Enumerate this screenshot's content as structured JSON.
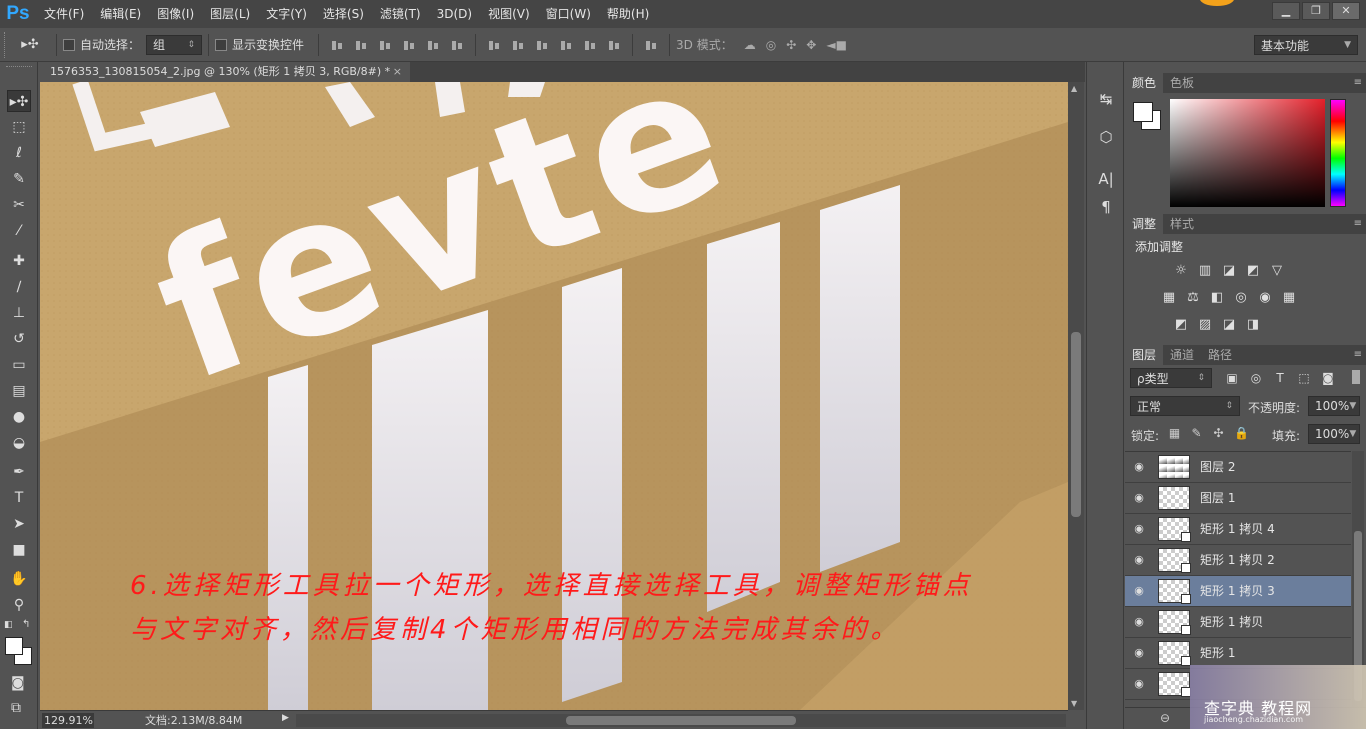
{
  "app": {
    "logo": "Ps"
  },
  "menu": [
    "文件(F)",
    "编辑(E)",
    "图像(I)",
    "图层(L)",
    "文字(Y)",
    "选择(S)",
    "滤镜(T)",
    "3D(D)",
    "视图(V)",
    "窗口(W)",
    "帮助(H)"
  ],
  "window_buttons": {
    "minimize": "▁",
    "restore": "❐",
    "close": "✕"
  },
  "options": {
    "tool_glyph": "▸✣",
    "auto_select_label": "自动选择：",
    "auto_select_value": "组",
    "show_transform_label": "显示变换控件",
    "mode3d_label": "3D 模式：",
    "workspace": "基本功能"
  },
  "document": {
    "tab_title": "1576353_130815054_2.jpg @ 130% (矩形 1 拷贝 3, RGB/8#) *",
    "tab_close": "×",
    "canvas_word": "fevte",
    "instruction_line1": "6.选择矩形工具拉一个矩形，选择直接选择工具，调整矩形锚点",
    "instruction_line2": "与文字对齐，然后复制4个矩形用相同的方法完成其余的。"
  },
  "status": {
    "zoom": "129.91%",
    "doc_info": "文档:2.13M/8.84M",
    "arrow": "▶"
  },
  "tools": [
    {
      "name": "move-tool-icon",
      "glyph": "▸✣",
      "active": true
    },
    {
      "name": "marquee-tool-icon",
      "glyph": "⬚"
    },
    {
      "name": "lasso-tool-icon",
      "glyph": "ℓ"
    },
    {
      "name": "quick-select-tool-icon",
      "glyph": "✎"
    },
    {
      "name": "crop-tool-icon",
      "glyph": "✂"
    },
    {
      "name": "eyedropper-tool-icon",
      "glyph": "⁄"
    },
    {
      "name": "healing-tool-icon",
      "glyph": "✚"
    },
    {
      "name": "brush-tool-icon",
      "glyph": "∕"
    },
    {
      "name": "stamp-tool-icon",
      "glyph": "⊥"
    },
    {
      "name": "history-brush-tool-icon",
      "glyph": "↺"
    },
    {
      "name": "eraser-tool-icon",
      "glyph": "▭"
    },
    {
      "name": "gradient-tool-icon",
      "glyph": "▤"
    },
    {
      "name": "blur-tool-icon",
      "glyph": "●"
    },
    {
      "name": "dodge-tool-icon",
      "glyph": "◒"
    },
    {
      "name": "pen-tool-icon",
      "glyph": "✒"
    },
    {
      "name": "type-tool-icon",
      "glyph": "T"
    },
    {
      "name": "path-select-tool-icon",
      "glyph": "➤"
    },
    {
      "name": "rectangle-tool-icon",
      "glyph": "■"
    },
    {
      "name": "hand-tool-icon",
      "glyph": "✋"
    },
    {
      "name": "zoom-tool-icon",
      "glyph": "⚲"
    }
  ],
  "mini_icons": [
    "↹",
    "⬡",
    "A|",
    "¶"
  ],
  "panels": {
    "color_tabs": [
      "颜色",
      "色板"
    ],
    "adjust_tabs": [
      "调整",
      "样式"
    ],
    "adjust_title": "添加调整",
    "adjust_icons": [
      "☼",
      "▥",
      "◪",
      "◩",
      "▽",
      "▦",
      "⚖",
      "◧",
      "◎",
      "◉",
      "▦",
      "◩",
      "▨",
      "◪",
      "◨"
    ],
    "layers_tabs": [
      "图层",
      "通道",
      "路径"
    ],
    "layer_kind": "ρ类型",
    "filter_icons": [
      "▣",
      "◎",
      "T",
      "⬚",
      "◙"
    ],
    "blend_mode": "正常",
    "opacity_label": "不透明度:",
    "opacity": "100%",
    "lock_label": "锁定:",
    "lock_icons": [
      "▦",
      "✎",
      "✣",
      "🔒"
    ],
    "fill_label": "填充:",
    "fill": "100%",
    "menu_glyph": "≡"
  },
  "layers": [
    {
      "name": "图层 2",
      "thumb": "grad",
      "shape": false
    },
    {
      "name": "图层 1",
      "thumb": "check",
      "shape": false
    },
    {
      "name": "矩形 1 拷贝 4",
      "thumb": "check",
      "shape": true
    },
    {
      "name": "矩形 1 拷贝 2",
      "thumb": "check",
      "shape": true
    },
    {
      "name": "矩形 1 拷贝 3",
      "thumb": "check",
      "shape": true,
      "selected": true
    },
    {
      "name": "矩形 1 拷贝",
      "thumb": "check",
      "shape": true
    },
    {
      "name": "矩形 1",
      "thumb": "check",
      "shape": true
    },
    {
      "name": "",
      "thumb": "check",
      "shape": true
    }
  ],
  "watermark": {
    "text": "查字典 教程网",
    "sub": "jiaocheng.chazidian.com"
  },
  "colors": {
    "accent": "#31a8ff",
    "selected_layer": "#6b7e9c",
    "instruction": "#ff1a1a",
    "canvas_bg": "#c4a36b"
  }
}
